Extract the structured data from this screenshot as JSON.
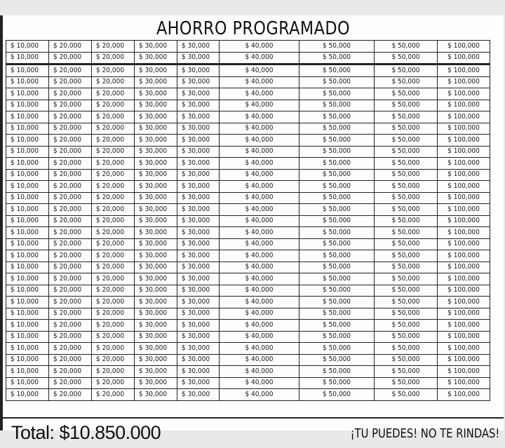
{
  "sheet": {
    "title": "AHORRO PROGRAMADO",
    "total": "Total: $10.850.000",
    "slogan": "¡TU PUEDES! NO TE RINDAS!"
  },
  "columns": [
    "$ 10,000",
    "$ 20,000",
    "$ 20,000",
    "$ 30,000",
    "$ 30,000",
    "$ 40,000",
    "$ 50,000",
    "$ 50,000",
    "$ 100,000"
  ],
  "row_count": 31
}
